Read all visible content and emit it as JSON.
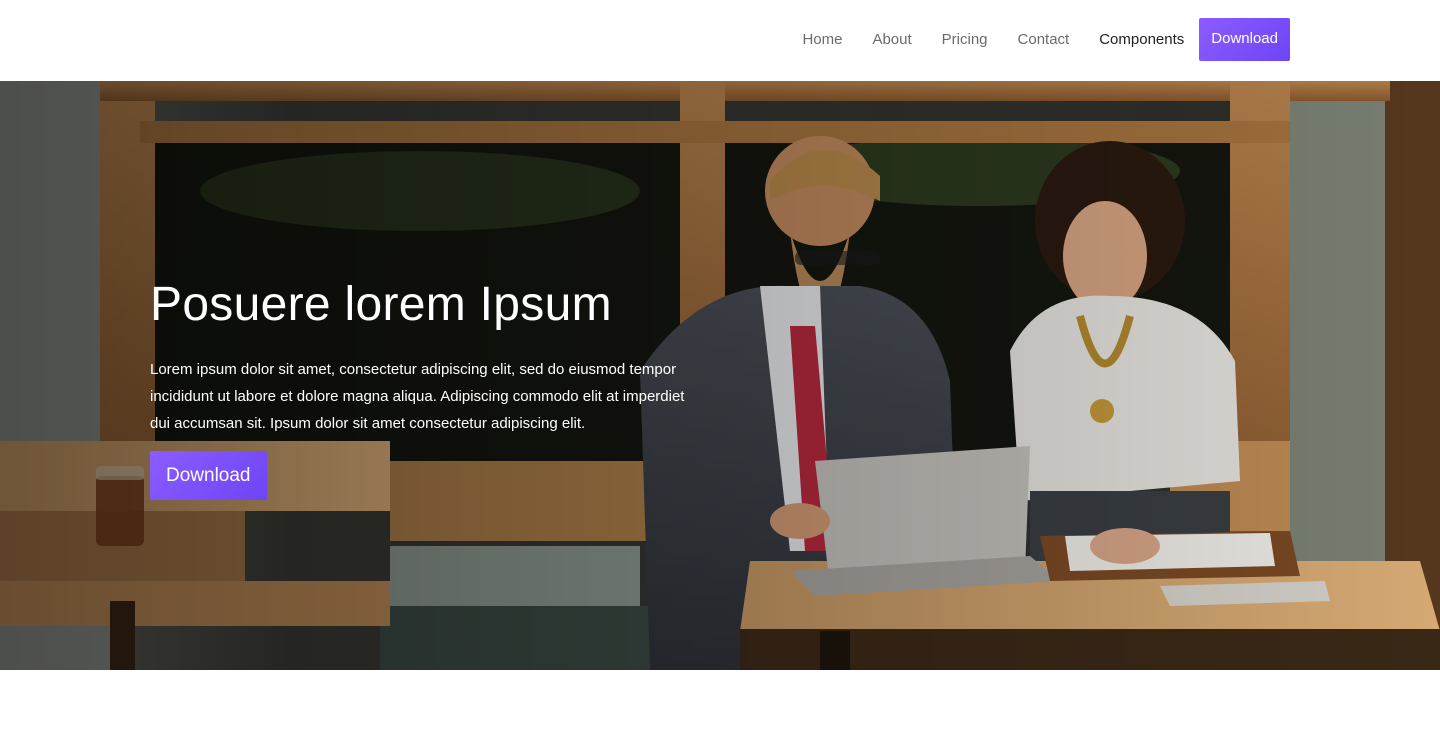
{
  "nav": {
    "items": [
      {
        "label": "Home"
      },
      {
        "label": "About"
      },
      {
        "label": "Pricing"
      },
      {
        "label": "Contact"
      },
      {
        "label": "Components"
      }
    ],
    "cta_label": "Download"
  },
  "hero": {
    "title": "Posuere lorem Ipsum",
    "text": "Lorem ipsum dolor sit amet, consectetur adipiscing elit, sed do eiusmod tempor incididunt ut labore et dolore magna aliqua. Adipiscing commodo elit at imperdiet dui accumsan sit. Ipsum dolor sit amet consectetur adipiscing elit.",
    "button_label": "Download"
  },
  "colors": {
    "accent": "#7b4dff",
    "nav_text": "#6b6b6b",
    "nav_active": "#222222"
  }
}
